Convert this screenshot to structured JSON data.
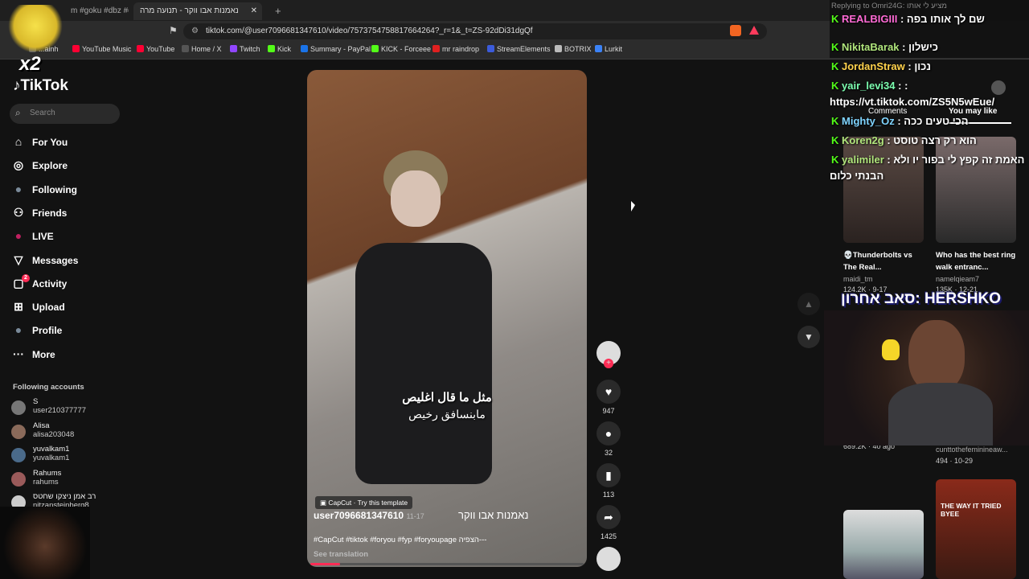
{
  "tabs": [
    {
      "label": "m #goku #dbz #drago"
    },
    {
      "label": "נאמנות אבו ווקר - תנועה מרה"
    },
    {
      "label": "+"
    }
  ],
  "address": {
    "url": "tiktok.com/@user7096681347610/video/7573754758817664264?_r=1&_t=ZS-92dDi31dgQf"
  },
  "bookmarks": [
    {
      "label": "...ainh",
      "color": "#666"
    },
    {
      "label": "YouTube Music",
      "color": "#ff0033"
    },
    {
      "label": "YouTube",
      "color": "#ff0033"
    },
    {
      "label": "Home / X",
      "color": "#555"
    },
    {
      "label": "Twitch",
      "color": "#9146ff"
    },
    {
      "label": "Kick",
      "color": "#53fc18"
    },
    {
      "label": "Summary - PayPal",
      "color": "#1a73e8"
    },
    {
      "label": "KICK - Forceee",
      "color": "#53fc18"
    },
    {
      "label": "mr raindrop",
      "color": "#e02020"
    },
    {
      "label": "StreamElements",
      "color": "#3b5bdb"
    },
    {
      "label": "BOTRIX",
      "color": "#bbb"
    },
    {
      "label": "Lurkit",
      "color": "#3b82f6"
    }
  ],
  "sidebar": {
    "logo": "TikTok",
    "search_placeholder": "Search",
    "nav": [
      {
        "label": "For You",
        "icon": "home-icon"
      },
      {
        "label": "Explore",
        "icon": "compass-icon"
      },
      {
        "label": "Following",
        "icon": "following-avatar"
      },
      {
        "label": "Friends",
        "icon": "friends-icon"
      },
      {
        "label": "LIVE",
        "icon": "live-avatar"
      },
      {
        "label": "Messages",
        "icon": "messages-icon"
      },
      {
        "label": "Activity",
        "icon": "activity-icon",
        "badge": "2"
      },
      {
        "label": "Upload",
        "icon": "upload-icon"
      },
      {
        "label": "Profile",
        "icon": "profile-avatar"
      },
      {
        "label": "More",
        "icon": "more-icon"
      }
    ],
    "following_header": "Following accounts",
    "accounts": [
      {
        "name": "S",
        "handle": "user210377777"
      },
      {
        "name": "Alisa",
        "handle": "alisa203048"
      },
      {
        "name": "yuvalkam1",
        "handle": "yuvalkam1"
      },
      {
        "name": "Rahums",
        "handle": "rahums"
      },
      {
        "name": "רב אמן ניצקו שחטס",
        "handle": "nitzansteinberg8"
      }
    ]
  },
  "video": {
    "caption_line1": "مثل ما قال اغليص",
    "caption_line2": "مابنسافق رخيص",
    "capcut": "CapCut · Try this template",
    "title_he": "נאמנות אבו ווקר",
    "author": "user7096681347610",
    "date": "11-17",
    "hashtags": "#CapCut #tiktok #foryou #fyp #foryoupage  הצפיה---",
    "see_translation": "See translation"
  },
  "actions": {
    "likes": "947",
    "comments": "32",
    "saves": "113",
    "shares": "1425"
  },
  "chat": {
    "reply_banner": "Replying to Omri24G: מציע לי אותו",
    "lines": [
      {
        "user": "REALBIGIII",
        "text": "שם לך אותו בפה",
        "color": "#ff6ad5"
      },
      {
        "user": "NikitaBarak",
        "text": "כישלון",
        "color": "#b0e57c"
      },
      {
        "user": "JordanStraw",
        "text": "נכון",
        "color": "#ffd24c"
      },
      {
        "user": "yair_levi34",
        "text": ":",
        "color": "#7cffb0"
      },
      {
        "user": "",
        "text": "https://vt.tiktok.com/ZS5N5wEue/",
        "color": "#fff"
      },
      {
        "user": "Mighty_Oz",
        "text": "הכי טעים ככה",
        "color": "#7fd4ff"
      },
      {
        "user": "Koren2g",
        "text": "הוא רק רצה טוסט",
        "color": "#b0e57c"
      },
      {
        "user": "yalimiler",
        "text": "האמת זה קפץ לי בפור יו ולא",
        "color": "#b0e57c"
      },
      {
        "user": "",
        "text": "הבנתי כלום",
        "color": "#fff"
      }
    ]
  },
  "right_panel": {
    "tabs": [
      "Comments",
      "You may like"
    ],
    "cards": [
      {
        "title": "💀Thunderbolts vs The Real...",
        "author": "maidi_tm",
        "stats": "124.2K · 9-17"
      },
      {
        "title": "Who has the best ring walk entranc...",
        "author": "namelqieam7",
        "stats": "135K · 12-21"
      },
      {
        "title": "",
        "author": "",
        "stats": "689.2K · 40 ago"
      },
      {
        "title": "",
        "author": "cunttothefeminineaw...",
        "stats": "494 · 10-29"
      }
    ],
    "thumb4_text": "THE WAY IT TRIED BYEE"
  },
  "overlay": {
    "multiplier": "x2",
    "last_sub": "סאב אחרון: HERSHKO"
  }
}
